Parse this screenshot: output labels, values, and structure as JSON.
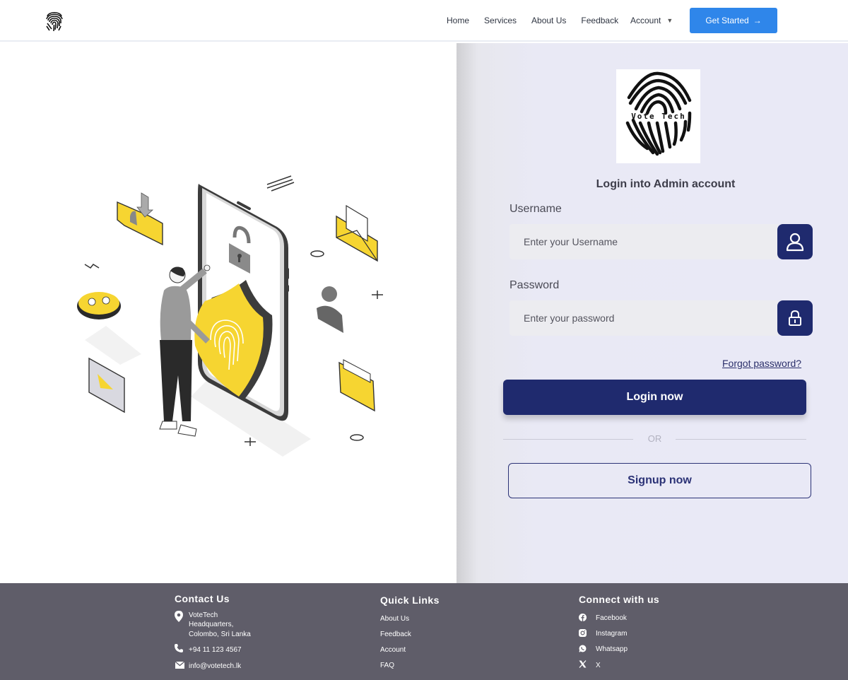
{
  "nav": {
    "links": [
      "Home",
      "Services",
      "About Us",
      "Feedback"
    ],
    "account_label": "Account",
    "cta_label": "Get Started",
    "cta_arrow": "→"
  },
  "brand": {
    "logo_text": "Vote Tech"
  },
  "login": {
    "title": "Login into Admin account",
    "username_label": "Username",
    "username_placeholder": "Enter your Username",
    "password_label": "Password",
    "password_placeholder": "Enter your password",
    "forgot_label": "Forgot password?",
    "login_label": "Login now",
    "or_label": "OR",
    "signup_label": "Signup now"
  },
  "footer": {
    "contact": {
      "heading": "Contact Us",
      "address_line1": "VoteTech",
      "address_line2": "Headquarters,",
      "address_line3": "Colombo, Sri Lanka",
      "phone": "+94 11 123 4567",
      "email": "info@votetech.lk"
    },
    "quick_links": {
      "heading": "Quick Links",
      "items": [
        "About Us",
        "Feedback",
        "Account",
        "FAQ"
      ]
    },
    "connect": {
      "heading": "Connect with us",
      "items": [
        "Facebook",
        "Instagram",
        "Whatsapp",
        "X"
      ]
    }
  },
  "colors": {
    "primary": "#1f2a6e",
    "cta": "#2f86ea",
    "accent_yellow": "#f6d531",
    "footer_bg": "#5f5d69"
  }
}
